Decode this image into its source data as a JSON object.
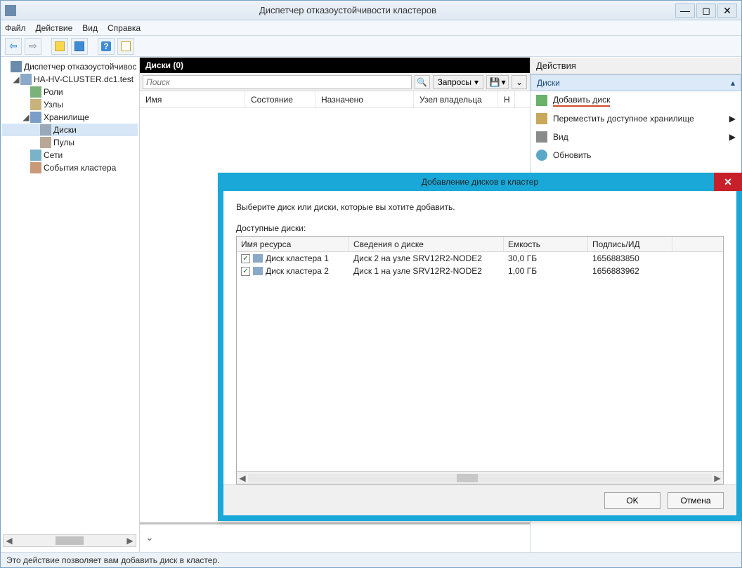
{
  "window": {
    "title": "Диспетчер отказоустойчивости кластеров"
  },
  "menubar": {
    "file": "Файл",
    "action": "Действие",
    "view": "Вид",
    "help": "Справка"
  },
  "tree": {
    "root": "Диспетчер отказоустойчивос",
    "cluster": "HA-HV-CLUSTER.dc1.test",
    "roles": "Роли",
    "nodes": "Узлы",
    "storage": "Хранилище",
    "disks": "Диски",
    "pools": "Пулы",
    "networks": "Сети",
    "events": "События кластера"
  },
  "center": {
    "header": "Диски (0)",
    "search_placeholder": "Поиск",
    "queries": "Запросы",
    "cols": {
      "name": "Имя",
      "state": "Состояние",
      "assigned": "Назначено",
      "owner": "Узел владельца",
      "n": "Н"
    }
  },
  "actions": {
    "title": "Действия",
    "group": "Диски",
    "add_disk": "Добавить диск",
    "move_storage": "Переместить доступное хранилище",
    "view": "Вид",
    "refresh": "Обновить"
  },
  "modal": {
    "title": "Добавление дисков в кластер",
    "instruction": "Выберите диск или диски, которые вы хотите добавить.",
    "available": "Доступные диски:",
    "cols": {
      "resource": "Имя ресурса",
      "info": "Сведения о диске",
      "capacity": "Емкость",
      "sig": "Подпись/ИД"
    },
    "rows": [
      {
        "checked": true,
        "name": "Диск кластера 1",
        "info": "Диск 2 на узле SRV12R2-NODE2",
        "capacity": "30,0 ГБ",
        "sig": "1656883850"
      },
      {
        "checked": true,
        "name": "Диск кластера 2",
        "info": "Диск 1 на узле SRV12R2-NODE2",
        "capacity": "1,00 ГБ",
        "sig": "1656883962"
      }
    ],
    "ok": "OK",
    "cancel": "Отмена"
  },
  "status": "Это действие позволяет вам добавить диск в кластер."
}
